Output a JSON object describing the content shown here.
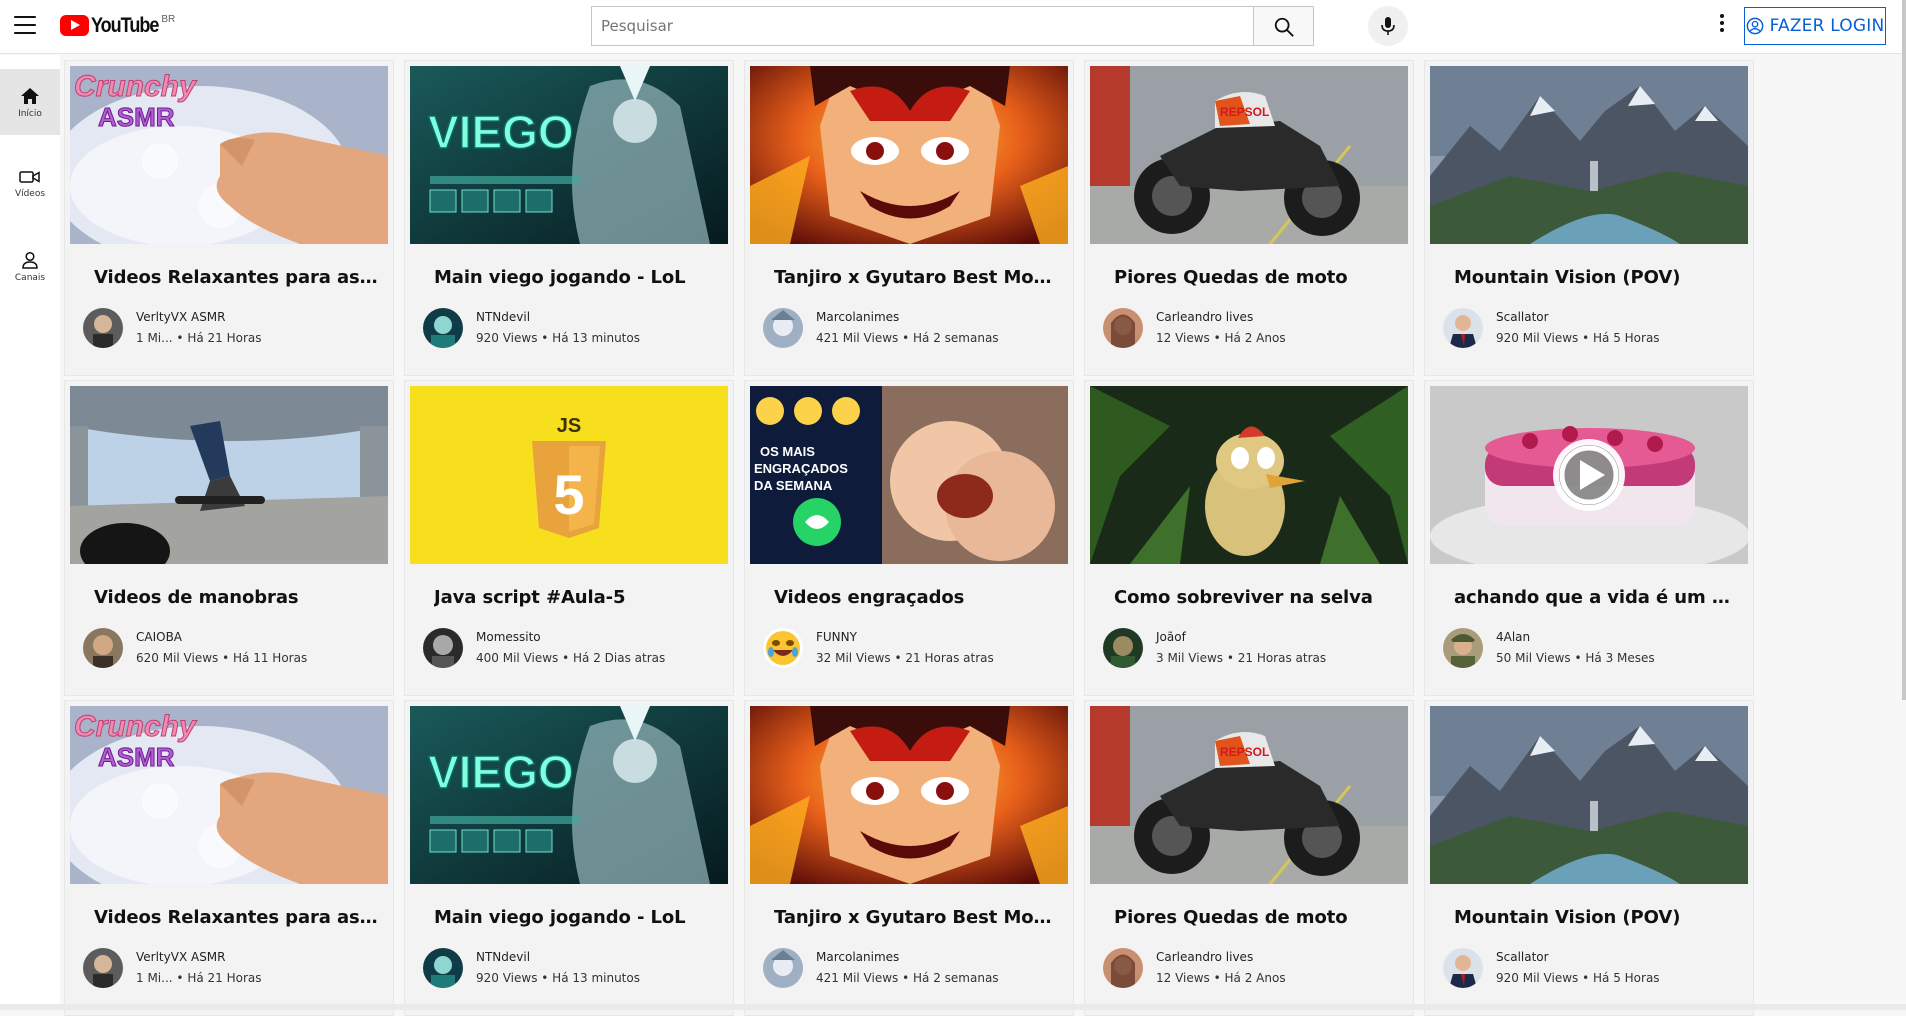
{
  "header": {
    "logo_text": "YouTube",
    "logo_country": "BR",
    "search_placeholder": "Pesquisar",
    "login_label": "FAZER LOGIN"
  },
  "sidebar": {
    "items": [
      {
        "label": "Início",
        "icon": "home-icon"
      },
      {
        "label": "Vídeos",
        "icon": "video-camera-icon"
      },
      {
        "label": "Canais",
        "icon": "person-icon"
      }
    ]
  },
  "videos": [
    {
      "title": "Videos Relaxantes para assistir",
      "channel": "VerltyVX ASMR",
      "views": "1 Mi...",
      "time": "Há 21 Horas",
      "thumb": "crunchy",
      "thumb_text": "Crunchy ASMR",
      "avatar": "asmr"
    },
    {
      "title": "Main viego jogando - LoL",
      "channel": "NTNdevil",
      "views": "920 Views",
      "time": "Há 13 minutos",
      "thumb": "viego",
      "thumb_text": "VIEGO",
      "avatar": "viego"
    },
    {
      "title": "Tanjiro x Gyutaro Best Moments",
      "channel": "Marcolanimes",
      "views": "421 Mil Views",
      "time": "Há 2 semanas",
      "thumb": "tanjiro",
      "avatar": "anime"
    },
    {
      "title": "Piores Quedas de moto",
      "channel": "Carleandro lives",
      "views": "12 Views",
      "time": "Há 2 Anos",
      "thumb": "moto",
      "thumb_text": "REPSOL",
      "avatar": "woman"
    },
    {
      "title": "Mountain Vision (POV)",
      "channel": "Scallator",
      "views": "920 Mil Views",
      "time": "Há 5 Horas",
      "thumb": "mountain",
      "avatar": "man-suit"
    },
    {
      "title": "Videos de manobras",
      "channel": "CAIOBA",
      "views": "620 Mil Views",
      "time": "Há 11 Horas",
      "thumb": "skate",
      "avatar": "man"
    },
    {
      "title": "Java script #Aula-5",
      "channel": "Momessito",
      "views": "400 Mil Views",
      "time": "Há 2 Dias atras",
      "thumb": "js",
      "thumb_text": "JS",
      "avatar": "dark"
    },
    {
      "title": "Videos engraçados",
      "channel": "FUNNY",
      "views": "32 Mil Views",
      "time": "21 Horas atras",
      "thumb": "funny",
      "thumb_text": "OS MAIS ENGRAÇADOS DA SEMANA",
      "avatar": "emoji"
    },
    {
      "title": "Como sobreviver na selva",
      "channel": "Joãof",
      "views": "3 Mil Views",
      "time": "21 Horas atras",
      "thumb": "jungle",
      "avatar": "jungle"
    },
    {
      "title": "achando que a vida é um mo...",
      "channel": "4Alan",
      "views": "50 Mil Views",
      "time": "Há 3 Meses",
      "thumb": "cake",
      "avatar": "soldier"
    },
    {
      "title": "Videos Relaxantes para assistir",
      "channel": "VerltyVX ASMR",
      "views": "1 Mi...",
      "time": "Há 21 Horas",
      "thumb": "crunchy",
      "thumb_text": "Crunchy ASMR",
      "avatar": "asmr"
    },
    {
      "title": "Main viego jogando - LoL",
      "channel": "NTNdevil",
      "views": "920 Views",
      "time": "Há 13 minutos",
      "thumb": "viego",
      "thumb_text": "VIEGO",
      "avatar": "viego"
    },
    {
      "title": "Tanjiro x Gyutaro Best Moments",
      "channel": "Marcolanimes",
      "views": "421 Mil Views",
      "time": "Há 2 semanas",
      "thumb": "tanjiro",
      "avatar": "anime"
    },
    {
      "title": "Piores Quedas de moto",
      "channel": "Carleandro lives",
      "views": "12 Views",
      "time": "Há 2 Anos",
      "thumb": "moto",
      "thumb_text": "REPSOL",
      "avatar": "woman"
    },
    {
      "title": "Mountain Vision (POV)",
      "channel": "Scallator",
      "views": "920 Mil Views",
      "time": "Há 5 Horas",
      "thumb": "mountain",
      "avatar": "man-suit"
    }
  ]
}
